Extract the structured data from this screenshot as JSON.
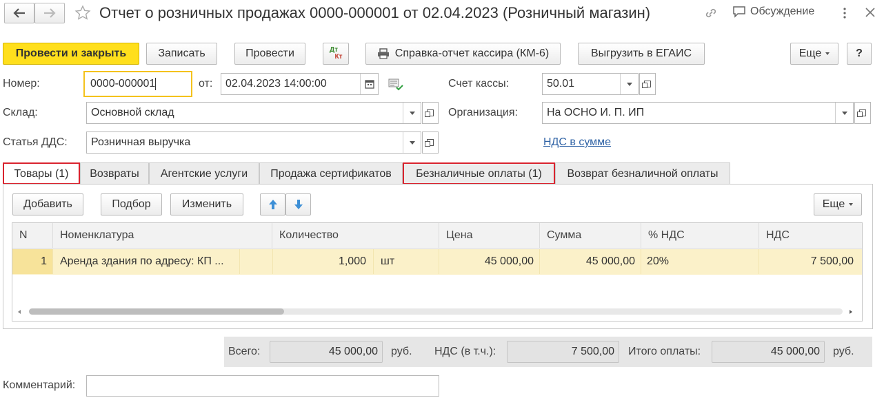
{
  "header": {
    "title": "Отчет о розничных продажах 0000-000001 от 02.04.2023 (Розничный магазин)",
    "discussion": "Обсуждение"
  },
  "toolbar": {
    "post_close": "Провести и закрыть",
    "save": "Записать",
    "post": "Провести",
    "dt_kt_top": "Дт",
    "dt_kt_bottom": "Кт",
    "cashier_report": "Справка-отчет кассира (КМ-6)",
    "egais": "Выгрузить в ЕГАИС",
    "more": "Еще",
    "help": "?"
  },
  "form": {
    "number_label": "Номер:",
    "number_value": "0000-000001",
    "date_label": "от:",
    "date_value": "02.04.2023 14:00:00",
    "cash_account_label": "Счет кассы:",
    "cash_account_value": "50.01",
    "warehouse_label": "Склад:",
    "warehouse_value": "Основной склад",
    "org_label": "Организация:",
    "org_value": "На ОСНО И. П. ИП",
    "dds_label": "Статья ДДС:",
    "dds_value": "Розничная выручка",
    "vat_link": "НДС в сумме"
  },
  "tabs": [
    {
      "label": "Товары (1)"
    },
    {
      "label": "Возвраты"
    },
    {
      "label": "Агентские услуги"
    },
    {
      "label": "Продажа сертификатов"
    },
    {
      "label": "Безналичные оплаты (1)"
    },
    {
      "label": "Возврат безналичной оплаты"
    }
  ],
  "table_toolbar": {
    "add": "Добавить",
    "select": "Подбор",
    "edit": "Изменить",
    "more": "Еще"
  },
  "table": {
    "columns": [
      "N",
      "Номенклатура",
      "Количество",
      "Цена",
      "Сумма",
      "% НДС",
      "НДС"
    ],
    "rows": [
      {
        "n": "1",
        "item": "Аренда здания по адресу: КП ...",
        "qty": "1,000",
        "unit": "шт",
        "price": "45 000,00",
        "sum": "45 000,00",
        "vat_rate": "20%",
        "vat": "7 500,00"
      }
    ]
  },
  "totals": {
    "total_label": "Всего:",
    "total_value": "45 000,00",
    "currency1": "руб.",
    "vat_label": "НДС (в т.ч.):",
    "vat_value": "7 500,00",
    "paid_label": "Итого оплаты:",
    "paid_value": "45 000,00",
    "currency2": "руб."
  },
  "comment": {
    "label": "Комментарий:",
    "value": ""
  },
  "colors": {
    "accent_button": "#ffdf1c",
    "highlight_row": "#fbf1c9",
    "tab_outline": "#d9232e",
    "link": "#3164a6"
  }
}
